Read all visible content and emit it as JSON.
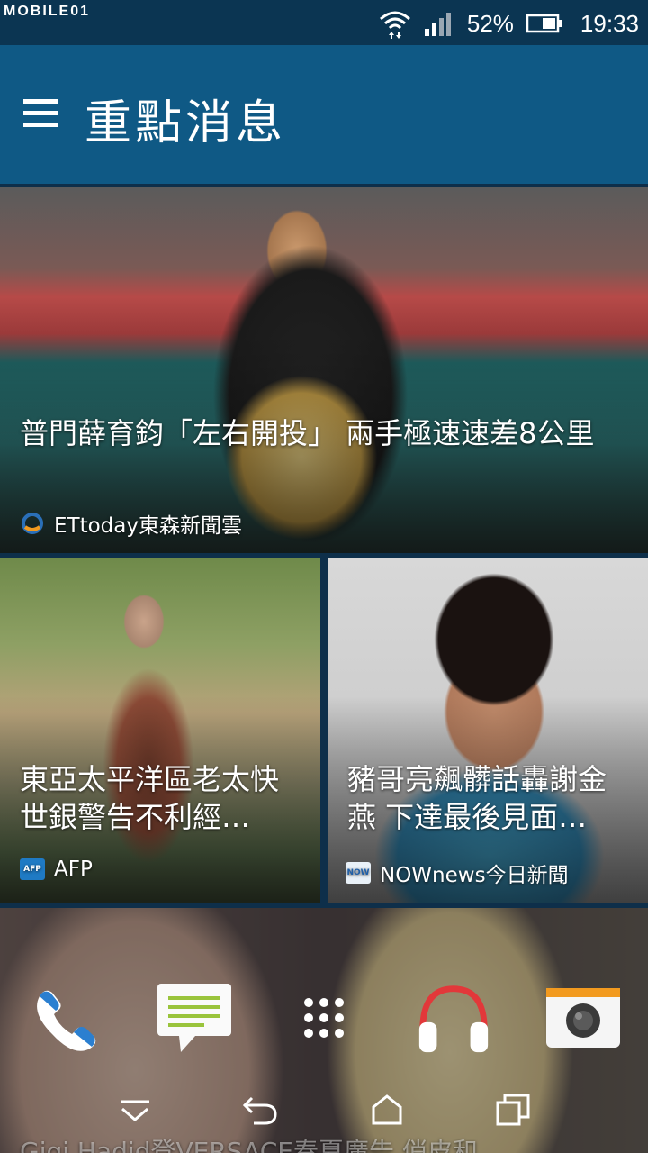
{
  "status": {
    "watermark": "MOBILE01",
    "battery": "52%",
    "time": "19:33"
  },
  "header": {
    "title": "重點消息"
  },
  "cards": [
    {
      "headline": "普門薛育鈞「左右開投」 兩手極速速差8公里",
      "source": "ETtoday東森新聞雲",
      "source_logo_color": "#2a6fb8"
    },
    {
      "headline": "東亞太平洋區老太快 世銀警告不利經…",
      "source": "AFP",
      "source_logo_color": "#1f7ac4"
    },
    {
      "headline": "豬哥亮飆髒話轟謝金燕 下達最後見面…",
      "source": "NOWnews今日新聞",
      "source_logo_color": "#e9f1f8"
    },
    {
      "headline": "Gigi Hadid登VERSACE春夏廣告 俏皮和…"
    }
  ],
  "dock": [
    {
      "icon": "phone-icon"
    },
    {
      "icon": "messages-icon"
    },
    {
      "icon": "app-drawer-icon"
    },
    {
      "icon": "music-headphones-icon"
    },
    {
      "icon": "camera-icon"
    }
  ],
  "nav": [
    {
      "icon": "notifications-pulldown-icon"
    },
    {
      "icon": "back-icon"
    },
    {
      "icon": "home-icon"
    },
    {
      "icon": "recents-icon"
    }
  ],
  "colors": {
    "status_bar": "#0b3552",
    "app_bar": "#0f5985",
    "accent_green": "#9ac43c",
    "headphone_red": "#e2383a",
    "phone_blue": "#2b7fd0"
  }
}
